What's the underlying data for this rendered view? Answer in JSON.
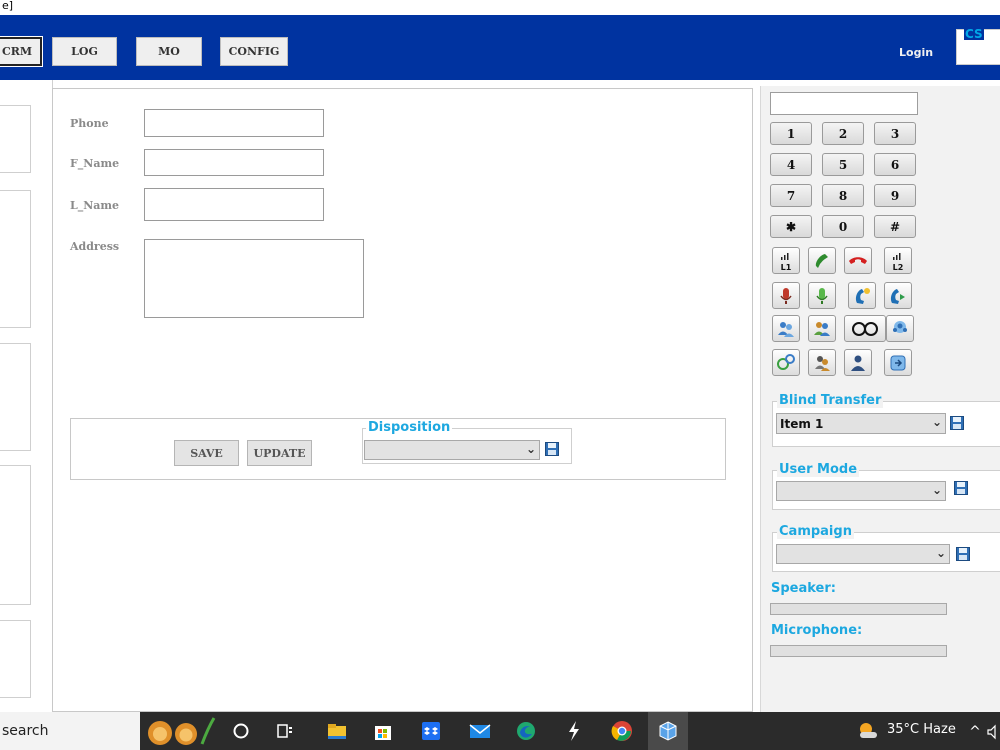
{
  "window": {
    "title_fragment": "e]"
  },
  "nav": {
    "items": [
      {
        "label": "CRM"
      },
      {
        "label": "LOG"
      },
      {
        "label": "MO"
      },
      {
        "label": "CONFIG"
      }
    ],
    "login_label": "Login",
    "cs_label": "CS"
  },
  "form": {
    "phone_label": "Phone",
    "fname_label": "F_Name",
    "lname_label": "L_Name",
    "address_label": "Address",
    "save_label": "SAVE",
    "update_label": "UPDATE",
    "disposition_legend": "Disposition",
    "disposition_value": ""
  },
  "dialer": {
    "keys": [
      "1",
      "2",
      "3",
      "4",
      "5",
      "6",
      "7",
      "8",
      "9",
      "✱",
      "0",
      "#"
    ],
    "line1_label": "L1",
    "line2_label": "L2"
  },
  "right": {
    "blind_transfer_legend": "Blind Transfer",
    "blind_transfer_value": "Item 1",
    "user_mode_legend": "User Mode",
    "user_mode_value": "",
    "campaign_legend": "Campaign",
    "campaign_value": "",
    "speaker_label": "Speaker:",
    "microphone_label": "Microphone:"
  },
  "taskbar": {
    "search_text": "search",
    "temperature": "35°C",
    "weather": "Haze"
  },
  "colors": {
    "topbar": "#0033a0",
    "accent": "#1da8e0"
  }
}
